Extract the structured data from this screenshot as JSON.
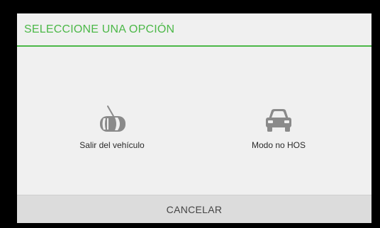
{
  "dialog": {
    "title": "SELECCIONE UNA OPCIÓN",
    "accent_color": "#4cb848",
    "options": [
      {
        "label": "Salir del vehículo",
        "icon": "car-door-open-icon"
      },
      {
        "label": "Modo no HOS",
        "icon": "car-front-icon"
      }
    ],
    "cancel_label": "CANCELAR"
  }
}
